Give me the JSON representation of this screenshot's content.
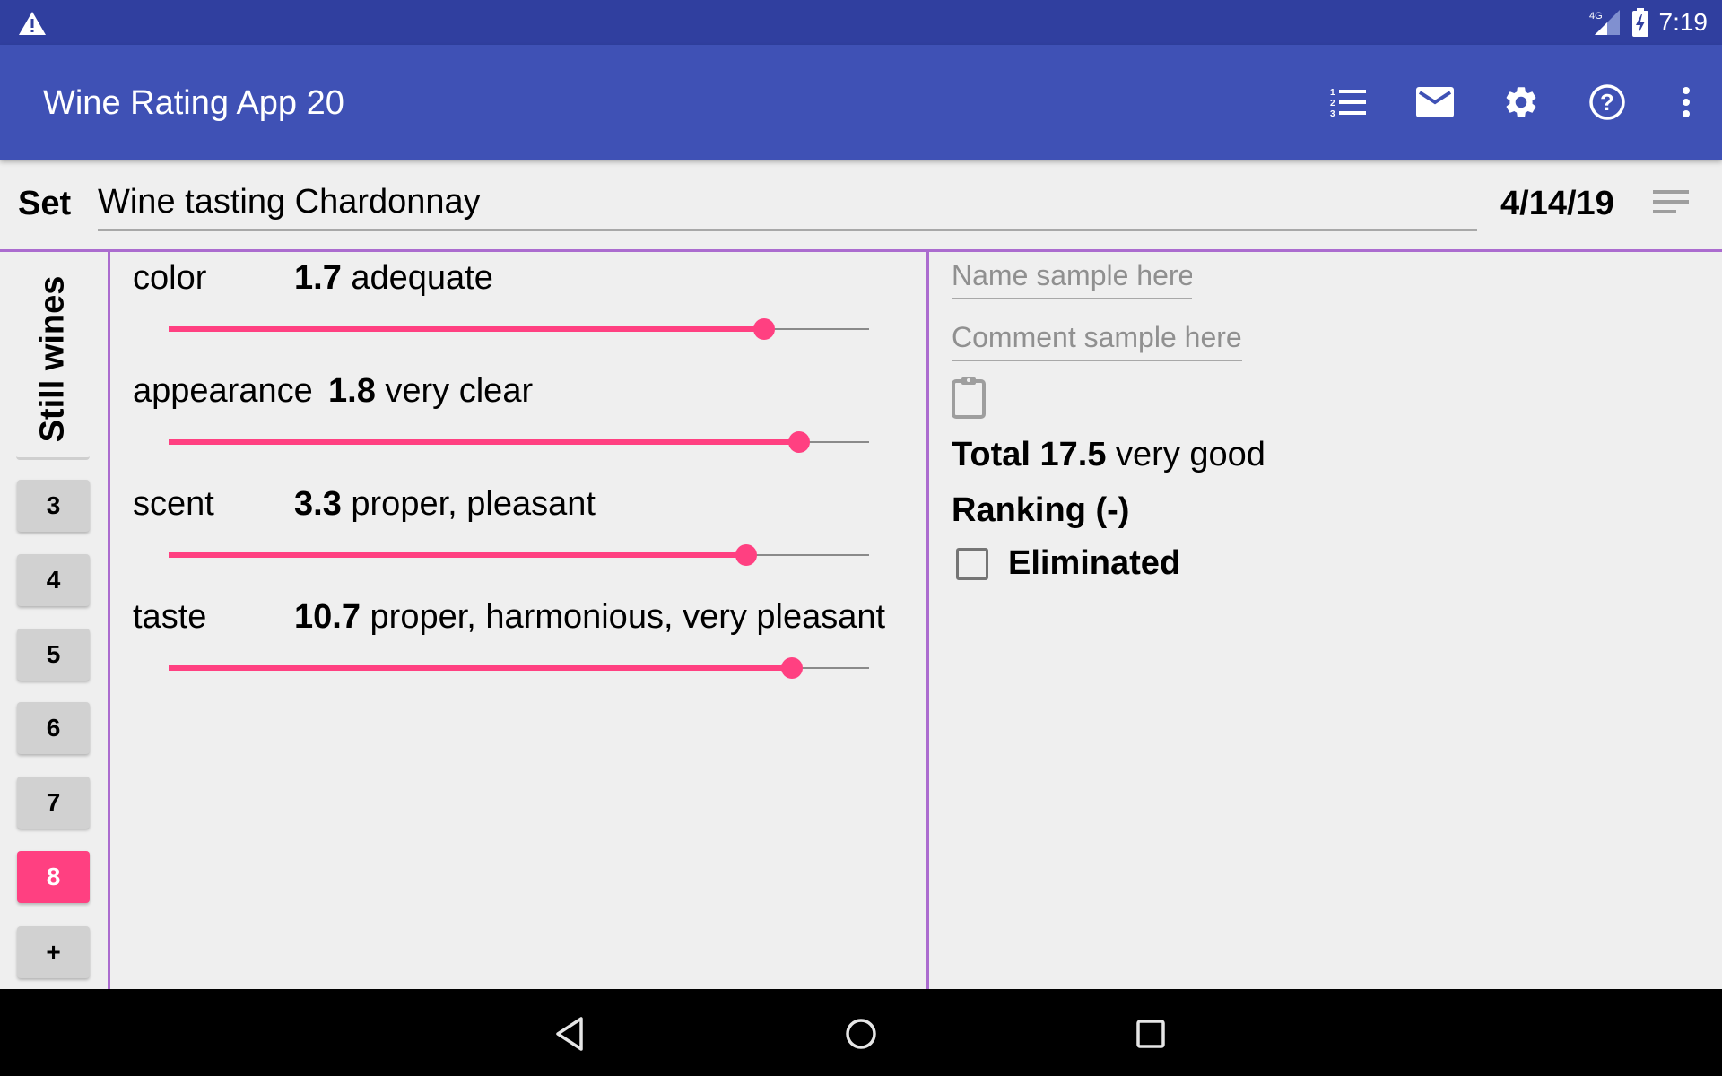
{
  "status_bar": {
    "time": "7:19",
    "network": "4G",
    "icons": [
      "warning-icon",
      "signal-icon",
      "battery-charging-icon"
    ]
  },
  "app_bar": {
    "title": "Wine Rating App 20",
    "actions": [
      {
        "name": "ranking-list",
        "icon": "numbered-list-icon"
      },
      {
        "name": "email",
        "icon": "mail-icon"
      },
      {
        "name": "settings",
        "icon": "gear-icon"
      },
      {
        "name": "help",
        "icon": "help-circle-icon"
      },
      {
        "name": "overflow-menu",
        "icon": "more-vert-icon"
      }
    ]
  },
  "set_row": {
    "label": "Set",
    "set_name": "Wine tasting Chardonnay",
    "date": "4/14/19",
    "sort_icon": "sort-icon"
  },
  "tabs": {
    "category": "Still wines",
    "samples": [
      "3",
      "4",
      "5",
      "6",
      "7",
      "8",
      "+"
    ],
    "active_sample": "8"
  },
  "criteria": [
    {
      "name": "color",
      "score": "1.7",
      "description": "adequate",
      "slider_fraction": 0.85
    },
    {
      "name": "appearance",
      "score": "1.8",
      "description": "very clear",
      "slider_fraction": 0.9
    },
    {
      "name": "scent",
      "score": "3.3",
      "description": "proper, pleasant",
      "slider_fraction": 0.825
    },
    {
      "name": "taste",
      "score": "10.7",
      "description": "proper, harmonious, very pleasant",
      "slider_fraction": 0.89
    }
  ],
  "detail": {
    "name_placeholder": "Name sample here",
    "comment_placeholder": "Comment sample here",
    "clipboard_icon": "clipboard-icon",
    "total_label": "Total 17.5",
    "total_description": "very good",
    "ranking": "Ranking (-)",
    "eliminated_label": "Eliminated",
    "eliminated_checked": false
  },
  "colors": {
    "status_bar": "#303f9f",
    "app_bar": "#3f51b5",
    "accent": "#ff4081",
    "divider": "#ab6ccf",
    "background": "#efefef"
  },
  "nav_bar": {
    "buttons": [
      "back-icon",
      "home-icon",
      "recents-icon"
    ]
  }
}
